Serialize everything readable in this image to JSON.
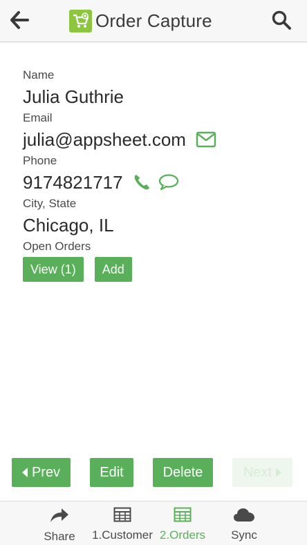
{
  "header": {
    "title": "Order Capture",
    "back_icon": "arrow-left-icon",
    "search_icon": "search-icon",
    "logo_icon": "cart-logo-icon"
  },
  "customer": {
    "name_label": "Name",
    "name_value": "Julia Guthrie",
    "email_label": "Email",
    "email_value": "julia@appsheet.com",
    "phone_label": "Phone",
    "phone_value": "9174821717",
    "city_label": "City, State",
    "city_value": "Chicago, IL",
    "orders_label": "Open Orders",
    "view_button": "View (1)",
    "add_button": "Add"
  },
  "nav_buttons": {
    "prev": "Prev",
    "edit": "Edit",
    "delete": "Delete",
    "next": "Next"
  },
  "tabs": [
    {
      "label": "Share",
      "icon": "share-icon",
      "active": false
    },
    {
      "label": "1.Customer",
      "icon": "table-icon",
      "active": false
    },
    {
      "label": "2.Orders",
      "icon": "table-icon",
      "active": true
    },
    {
      "label": "Sync",
      "icon": "cloud-icon",
      "active": false
    }
  ],
  "colors": {
    "accent": "#5ab05a",
    "logo": "#8cc63f",
    "header_bg": "#f7f7f7"
  }
}
